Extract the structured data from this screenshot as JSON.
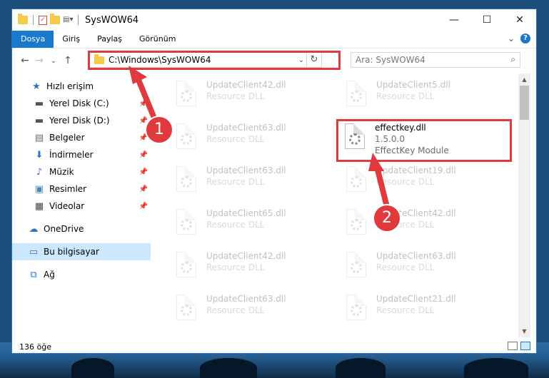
{
  "window": {
    "title": "SysWOW64",
    "controls": [
      "—",
      "☐",
      "✕"
    ]
  },
  "ribbon": {
    "tabs": [
      "Dosya",
      "Giriş",
      "Paylaş",
      "Görünüm"
    ],
    "expand": "⌄",
    "help": "?"
  },
  "navbar": {
    "back": "←",
    "forward": "→",
    "recent": "⌄",
    "up": "↑",
    "address": "C:\\Windows\\SysWOW64",
    "address_dropdown": "⌄",
    "refresh": "↻",
    "search_placeholder": "Ara: SysWOW64",
    "search_icon": "⌕"
  },
  "sidebar": {
    "items": [
      {
        "label": "Hızlı erişim",
        "icon": "star-icon",
        "glyph": "★",
        "color": "#2b76c2",
        "pinned": false
      },
      {
        "label": "Yerel Disk (C:)",
        "icon": "drive-icon",
        "glyph": "▬",
        "color": "#555555",
        "pinned": true
      },
      {
        "label": "Yerel Disk (D:)",
        "icon": "drive-icon",
        "glyph": "▬",
        "color": "#555555",
        "pinned": true
      },
      {
        "label": "Belgeler",
        "icon": "documents-icon",
        "glyph": "▤",
        "color": "#6b6b6b",
        "pinned": true
      },
      {
        "label": "İndirmeler",
        "icon": "download-icon",
        "glyph": "⬇",
        "color": "#2b76c2",
        "pinned": true
      },
      {
        "label": "Müzik",
        "icon": "music-icon",
        "glyph": "♪",
        "color": "#2b76c2",
        "pinned": true
      },
      {
        "label": "Resimler",
        "icon": "pictures-icon",
        "glyph": "▣",
        "color": "#4a86b8",
        "pinned": true
      },
      {
        "label": "Videolar",
        "icon": "videos-icon",
        "glyph": "▦",
        "color": "#444444",
        "pinned": true
      },
      {
        "label": "OneDrive",
        "icon": "cloud-icon",
        "glyph": "☁",
        "color": "#2b76c2",
        "pinned": false
      },
      {
        "label": "Bu bilgisayar",
        "icon": "computer-icon",
        "glyph": "▭",
        "color": "#2b76c2",
        "pinned": false,
        "selected": true
      },
      {
        "label": "Ağ",
        "icon": "network-icon",
        "glyph": "⧉",
        "color": "#2b76c2",
        "pinned": false
      }
    ]
  },
  "files": [
    {
      "name": "UpdateClient42.dll",
      "type": "Resource DLL"
    },
    {
      "name": "UpdateClient5.dll",
      "type": "Resource DLL"
    },
    {
      "name": "UpdateClient63.dll",
      "type": "Resource DLL"
    },
    {
      "name": "effectkey.dll",
      "version": "1.5.0.0",
      "type": "EffectKey Module"
    },
    {
      "name": "UpdateClient63.dll",
      "type": "Resource DLL"
    },
    {
      "name": "UpdateClient19.dll",
      "type": "Resource DLL"
    },
    {
      "name": "UpdateClient65.dll",
      "type": "Resource DLL"
    },
    {
      "name": "UpdateClient42.dll",
      "type": "Resource DLL"
    },
    {
      "name": "UpdateClient42.dll",
      "type": "Resource DLL"
    },
    {
      "name": "UpdateClient63.dll",
      "type": "Resource DLL"
    },
    {
      "name": "UpdateClient63.dll",
      "type": "Resource DLL"
    },
    {
      "name": "UpdateClient21.dll",
      "type": "Resource DLL"
    }
  ],
  "status": {
    "count": "136 öğe"
  },
  "callouts": [
    "1",
    "2"
  ],
  "colors": {
    "accent": "#1979ca",
    "highlight": "#e0393e"
  }
}
